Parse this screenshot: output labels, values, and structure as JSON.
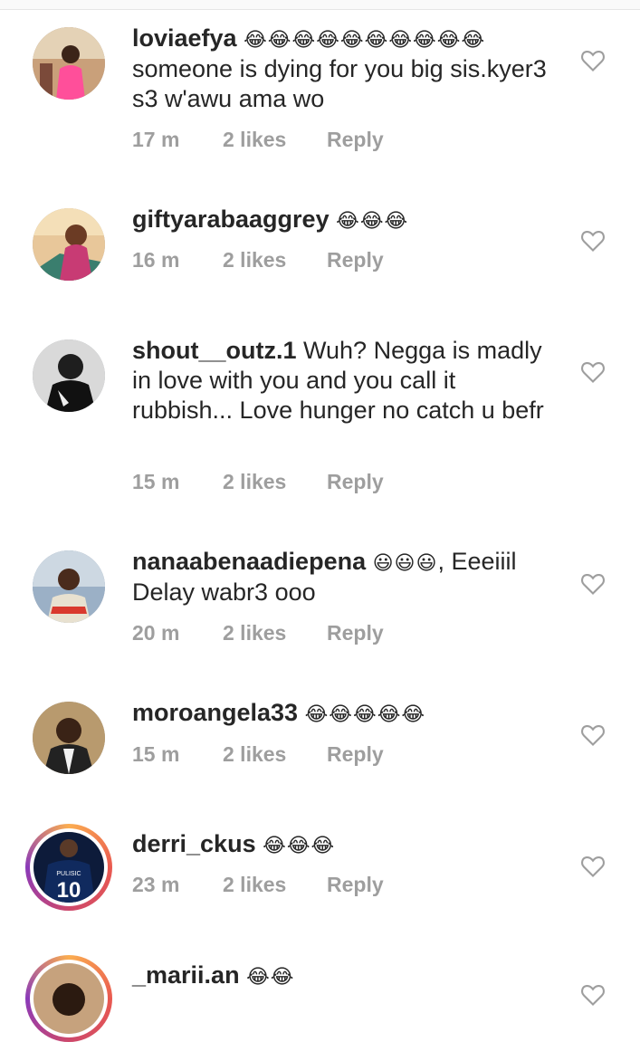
{
  "comments": [
    {
      "username": "loviaefya",
      "emoji": "😂😂😂😂😂😂😂😂😂😂",
      "body": "someone is dying for you big sis.kyer3 s3 w'awu ama wo",
      "time": "17 m",
      "likes": "2 likes",
      "reply": "Reply"
    },
    {
      "username": "giftyarabaaggrey",
      "emoji": "😂😂😂",
      "body": "",
      "time": "16 m",
      "likes": "2 likes",
      "reply": "Reply"
    },
    {
      "username": "shout__outz.1",
      "emoji": "",
      "body": "Wuh? Negga is madly in love with you and  you call it rubbish... Love hunger no catch u befr",
      "time": "15 m",
      "likes": "2 likes",
      "reply": "Reply"
    },
    {
      "username": "nanaabenaadiepena",
      "emoji": "😃😃😃",
      "body": ", Eeeiiil Delay wabr3 ooo",
      "time": "20 m",
      "likes": "2 likes",
      "reply": "Reply"
    },
    {
      "username": "moroangela33",
      "emoji": "😂😂😂😂😂",
      "body": "",
      "time": "15 m",
      "likes": "2 likes",
      "reply": "Reply"
    },
    {
      "username": "derri_ckus",
      "emoji": "😂😂😂",
      "body": "",
      "time": "23 m",
      "likes": "2 likes",
      "reply": "Reply",
      "avatar_text": "10",
      "avatar_name": "PULISIC"
    },
    {
      "username": "_marii.an",
      "emoji": "😂😂",
      "body": ""
    }
  ],
  "icons": {
    "like": "heart-outline-icon"
  },
  "colors": {
    "meta": "#9e9e9e",
    "text": "#262626",
    "ring": "#e95950"
  }
}
